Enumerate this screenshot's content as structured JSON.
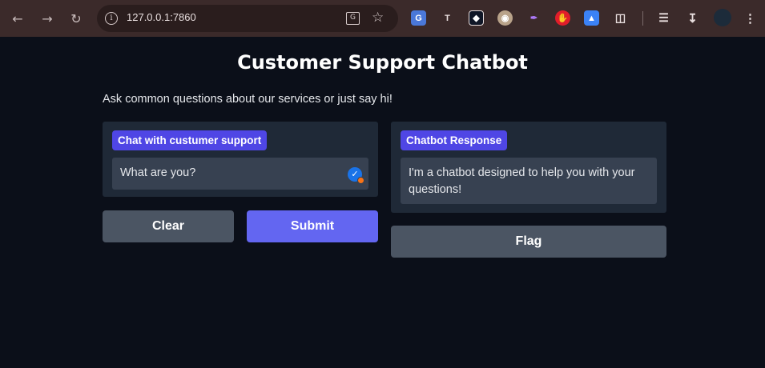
{
  "browser": {
    "url": "127.0.0.1:7860",
    "back_icon": "arrow-left-icon",
    "forward_icon": "arrow-right-icon",
    "reload_icon": "reload-icon"
  },
  "page": {
    "title": "Customer Support Chatbot",
    "subtitle": "Ask common questions about our services or just say hi!"
  },
  "input_panel": {
    "label": "Chat with custumer support",
    "value": "What are you?"
  },
  "output_panel": {
    "label": "Chatbot Response",
    "value": "I'm a chatbot designed to help you with your questions!"
  },
  "buttons": {
    "clear": "Clear",
    "submit": "Submit",
    "flag": "Flag"
  },
  "colors": {
    "background": "#0b0f19",
    "panel": "#1f2937",
    "accent": "#4f46e5",
    "primary_button": "#6366f1",
    "secondary_button": "#4b5563"
  }
}
